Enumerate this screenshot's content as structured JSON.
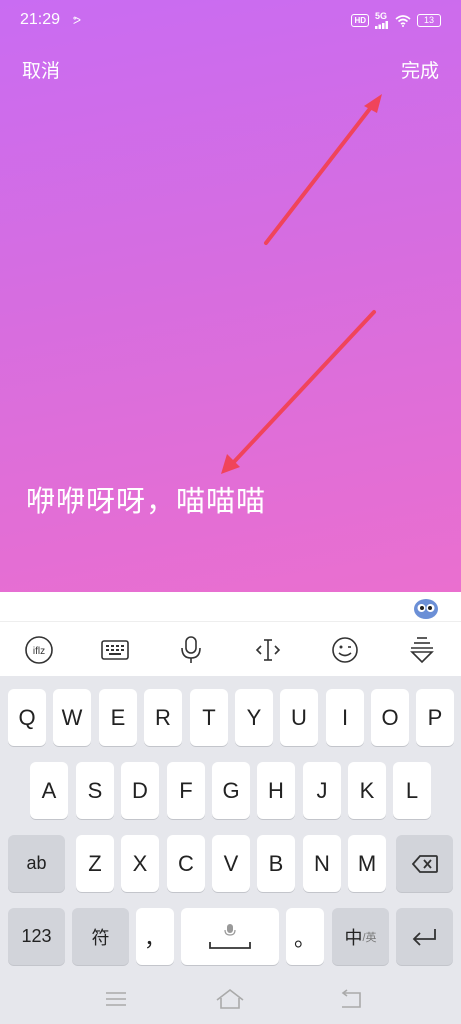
{
  "status_bar": {
    "time": "21:29",
    "notify_symbol": "ᕗ",
    "hd": "HD",
    "network": "5G",
    "battery": "13"
  },
  "header": {
    "cancel_label": "取消",
    "done_label": "完成"
  },
  "caption_text": "咿咿呀呀，喵喵喵",
  "keyboard": {
    "row1": [
      "Q",
      "W",
      "E",
      "R",
      "T",
      "Y",
      "U",
      "I",
      "O",
      "P"
    ],
    "row2": [
      "A",
      "S",
      "D",
      "F",
      "G",
      "H",
      "J",
      "K",
      "L"
    ],
    "row3": [
      "Z",
      "X",
      "C",
      "V",
      "B",
      "N",
      "M"
    ],
    "shift_label": "ab",
    "num_label": "123",
    "symbol_label": "符",
    "comma_label": "，",
    "period_label": "。",
    "lang_main": "中",
    "lang_sub": "/英"
  },
  "colors": {
    "arrow": "#f0445b"
  }
}
